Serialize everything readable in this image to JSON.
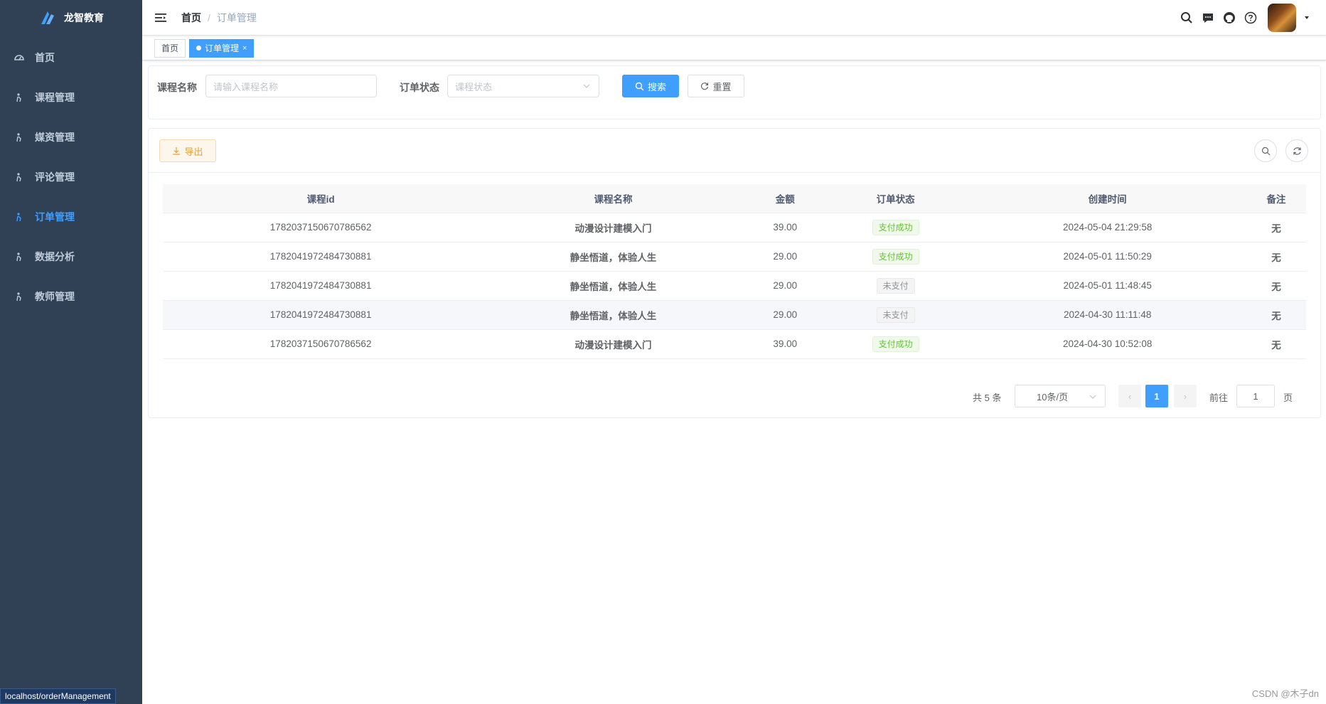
{
  "app": {
    "name": "龙智教育"
  },
  "sidebar": {
    "items": [
      {
        "label": "首页",
        "icon": "dashboard-icon",
        "active": false
      },
      {
        "label": "课程管理",
        "icon": "person-icon",
        "active": false
      },
      {
        "label": "媒资管理",
        "icon": "person-icon",
        "active": false
      },
      {
        "label": "评论管理",
        "icon": "person-icon",
        "active": false
      },
      {
        "label": "订单管理",
        "icon": "person-icon",
        "active": true
      },
      {
        "label": "数据分析",
        "icon": "person-icon",
        "active": false
      },
      {
        "label": "教师管理",
        "icon": "person-icon",
        "active": false
      }
    ]
  },
  "navbar": {
    "breadcrumb": {
      "home": "首页",
      "separator": "/",
      "current": "订单管理"
    }
  },
  "tags": [
    {
      "label": "首页",
      "active": false
    },
    {
      "label": "订单管理",
      "active": true,
      "close": "×"
    }
  ],
  "search": {
    "course_name_label": "课程名称",
    "course_name_placeholder": "请输入课程名称",
    "status_label": "订单状态",
    "status_placeholder": "课程状态",
    "search_button": "搜索",
    "reset_button": "重置"
  },
  "toolbar": {
    "export_button": "导出"
  },
  "table": {
    "columns": [
      "课程id",
      "课程名称",
      "金额",
      "订单状态",
      "创建时间",
      "备注"
    ],
    "rows": [
      {
        "id": "1782037150670786562",
        "name": "动漫设计建模入门",
        "amount": "39.00",
        "status": "支付成功",
        "status_type": "success",
        "created": "2024-05-04 21:29:58",
        "remark": "无"
      },
      {
        "id": "1782041972484730881",
        "name": "静坐悟道，体验人生",
        "amount": "29.00",
        "status": "支付成功",
        "status_type": "success",
        "created": "2024-05-01 11:50:29",
        "remark": "无"
      },
      {
        "id": "1782041972484730881",
        "name": "静坐悟道，体验人生",
        "amount": "29.00",
        "status": "未支付",
        "status_type": "unpaid",
        "created": "2024-05-01 11:48:45",
        "remark": "无"
      },
      {
        "id": "1782041972484730881",
        "name": "静坐悟道，体验人生",
        "amount": "29.00",
        "status": "未支付",
        "status_type": "unpaid",
        "created": "2024-04-30 11:11:48",
        "remark": "无"
      },
      {
        "id": "1782037150670786562",
        "name": "动漫设计建模入门",
        "amount": "39.00",
        "status": "支付成功",
        "status_type": "success",
        "created": "2024-04-30 10:52:08",
        "remark": "无"
      }
    ]
  },
  "pagination": {
    "total": "共 5 条",
    "page_size": "10条/页",
    "prev": "‹",
    "current": "1",
    "next": "›",
    "goto_label": "前往",
    "goto_value": "1",
    "page_label": "页"
  },
  "status_bar": {
    "url": "localhost/orderManagement"
  },
  "watermark": "CSDN @木子dn",
  "colors": {
    "sidebar_bg": "#304156",
    "accent": "#409eff",
    "success": "#67c23a",
    "warning": "#e6a23c"
  }
}
